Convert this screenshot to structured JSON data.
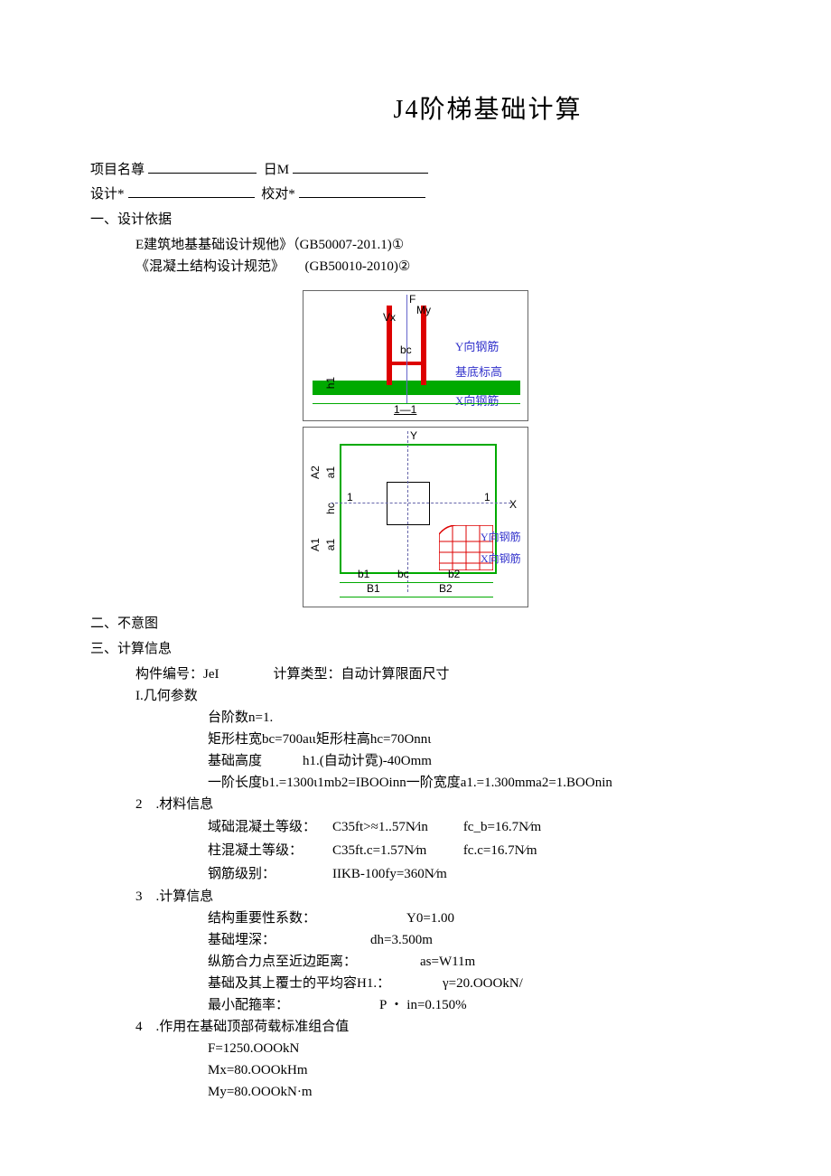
{
  "title": "J4阶梯基础计算",
  "meta": {
    "project_label": "项目名尊",
    "date_label": "日M",
    "design_label": "设计*",
    "check_label": "校对*"
  },
  "sections": {
    "s1": {
      "heading": "一、设计依据",
      "lines": [
        "E建筑地基基础设计规他》（GB50007-201.1)①",
        "《混凝土结构设计规范》　　(GB50010-2010)②"
      ]
    },
    "s2": {
      "heading": "二、不意图"
    },
    "s3": {
      "heading": "三、计算信息",
      "component_line": "构件编号：JeI　　　　计算类型：自动计算限面尺寸",
      "geo": {
        "title": "I.几何参数",
        "rows": [
          "台阶数n=1.",
          "矩形柱宽bc=700aιι矩形柱高hc=70Onnι",
          "基础高度　　　h1.(自动计霓)-40Omm",
          "一阶长度b1.=1300ι1mb2=IBOOinn一阶宽度a1.=1.300mma2=1.BOOnin"
        ]
      },
      "mat": {
        "title": "2　.材料信息",
        "rows": [
          {
            "c1": "域础混凝土等级：",
            "c2": "C35ft>≈1..57N∕in",
            "c3": "fc_b=16.7N∕m"
          },
          {
            "c1": "柱混凝土等级：",
            "c2": "C35ft.c=1.57N∕m",
            "c3": "fc.c=16.7N∕m"
          },
          {
            "c1": "钢筋级别：",
            "c2": "IIKB-100fy=360N∕m",
            "c3": ""
          }
        ]
      },
      "calc": {
        "title": "3　.计算信息",
        "rows": [
          {
            "lbl": "结构重要性系数：",
            "val": "Y0=1.00"
          },
          {
            "lbl": "基础埋深：",
            "val": "dh=3.500m"
          },
          {
            "lbl": "纵筋合力点至近边距离：",
            "val": "as=W11m"
          },
          {
            "lbl": "基础及其上覆士的平均容H1.：",
            "val": "γ=20.OOOkN/"
          },
          {
            "lbl": "最小配箍率：",
            "val": "P ・ in=0.150%"
          }
        ]
      },
      "load": {
        "title": "4　.作用在基础顶部荷载标准组合值",
        "rows": [
          "F=1250.OOOkN",
          "Mx=80.OOOkHm",
          "My=80.OOOkN·m"
        ]
      }
    }
  },
  "diagram_labels": {
    "F": "F",
    "My": "My",
    "Vx": "Vx",
    "bc": "bc",
    "h1": "h1",
    "sec": "1—1",
    "ybar": "Y向钢筋",
    "xbar": "X向钢筋",
    "baseelev": "基底标高",
    "Y": "Y",
    "X": "X",
    "hc": "hc",
    "A2": "A2",
    "A1": "A1",
    "a1": "a1",
    "a1_2": "a1",
    "b1": "b1",
    "bc2": "bc",
    "b2": "b2",
    "B1": "B1",
    "B2": "B2",
    "ybar2": "Y向钢筋",
    "xbar2": "X向钢筋",
    "one_l": "1",
    "one_r": "1"
  }
}
